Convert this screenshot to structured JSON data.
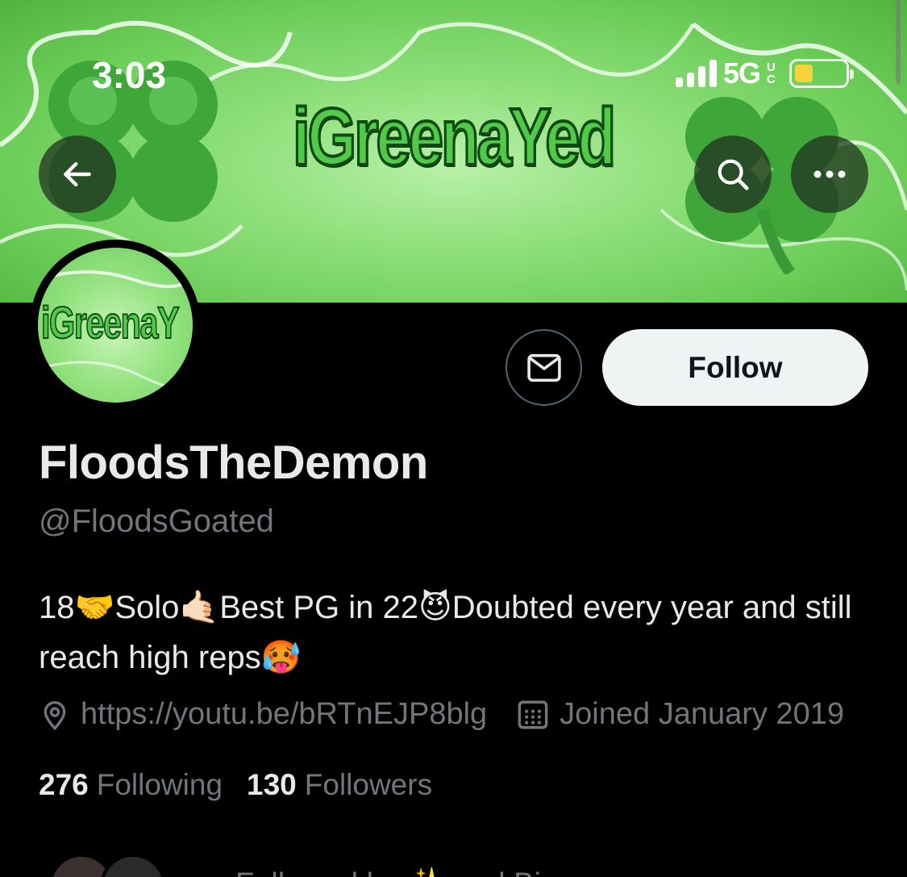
{
  "status_bar": {
    "time": "3:03",
    "network": "5G",
    "network_badge": "UC",
    "battery_color": "#f5d33b"
  },
  "banner": {
    "title": "iGreenaYed"
  },
  "nav": {
    "back_icon": "arrow-left-icon",
    "search_icon": "search-icon",
    "more_icon": "more-horizontal-icon"
  },
  "avatar": {
    "text": "iGreenaY"
  },
  "actions": {
    "message_icon": "mail-icon",
    "follow_label": "Follow"
  },
  "profile": {
    "display_name": "FloodsTheDemon",
    "handle": "@FloodsGoated",
    "bio_parts": [
      "18",
      "🤝",
      "Solo",
      "🤙🏻",
      "Best PG in 22",
      "😈",
      "Doubted every year and still reach high reps",
      "🥵"
    ],
    "website": "https://youtu.be/bRTnEJP8blg",
    "joined": "Joined January 2019"
  },
  "stats": {
    "following_count": "276",
    "following_label": "Following",
    "followers_count": "130",
    "followers_label": "Followers"
  },
  "followed_by": {
    "text": "Followed by ✨ and Bi"
  },
  "colors": {
    "background": "#000000",
    "primary_text": "#e7e9ea",
    "secondary_text": "#71767b",
    "follow_bg": "#eff3f4",
    "banner_green": "#6ccd58"
  }
}
